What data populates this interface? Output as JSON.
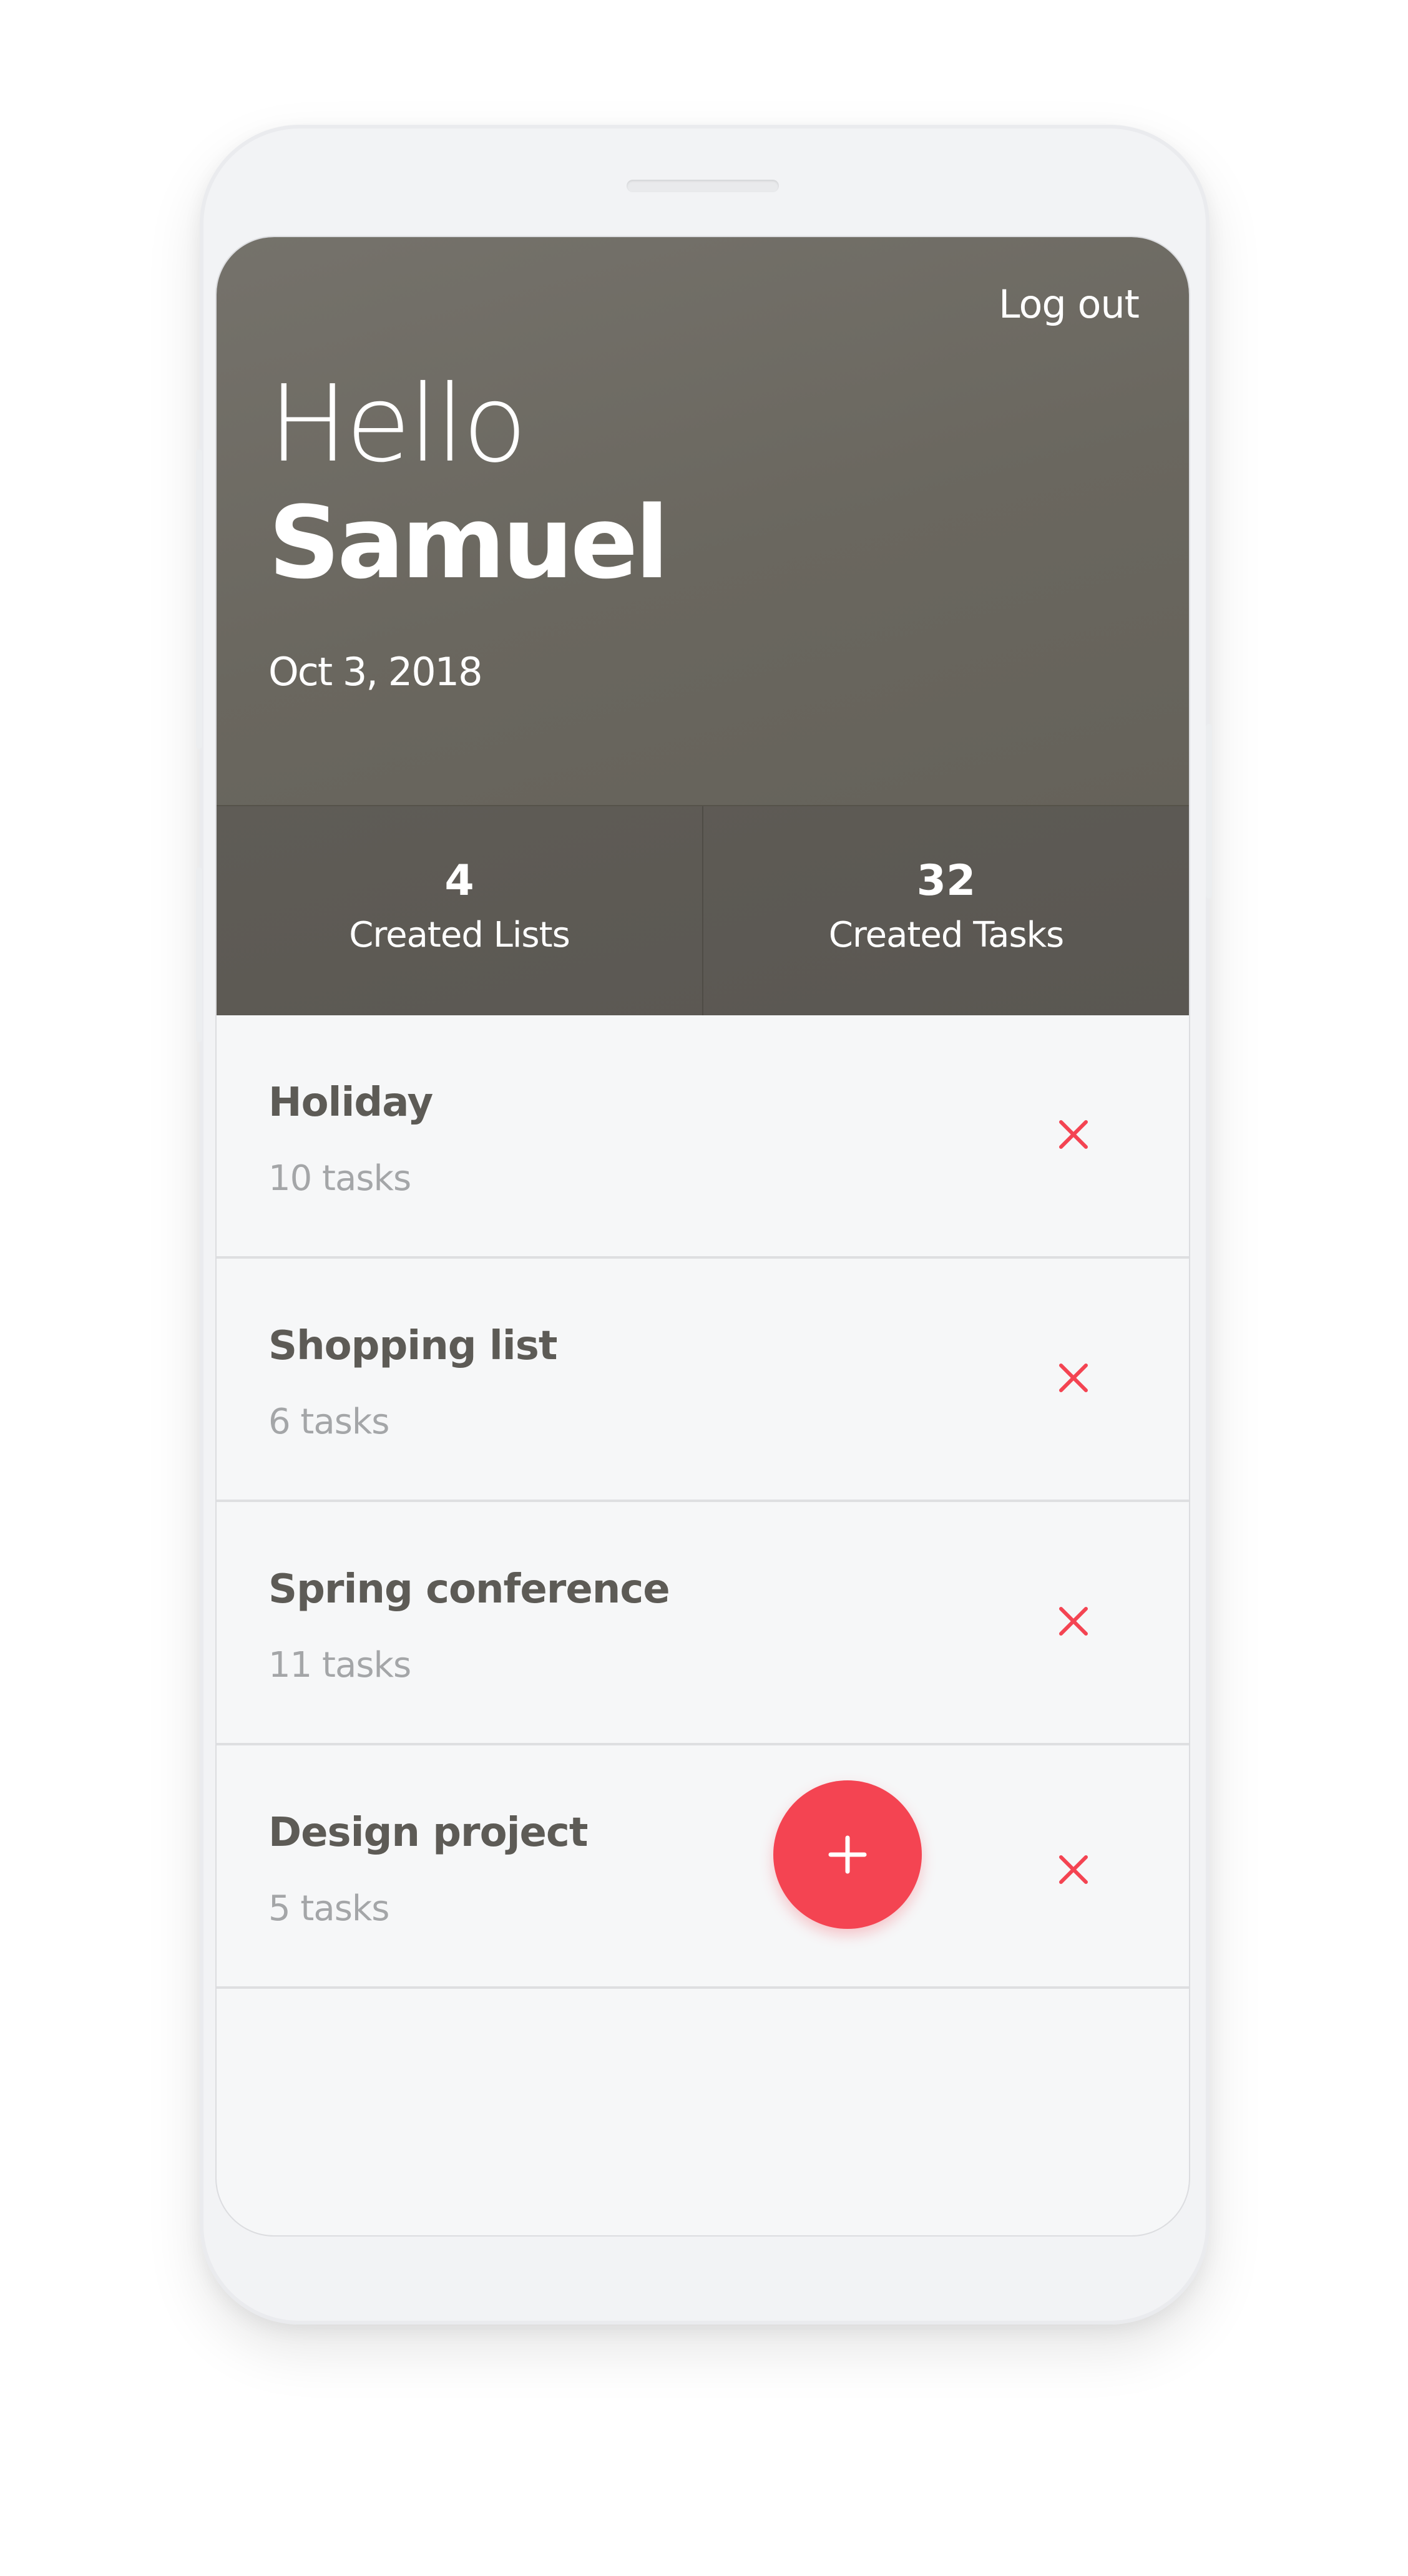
{
  "header": {
    "logout_label": "Log out",
    "greeting": "Hello",
    "user_name": "Samuel",
    "date": "Oct 3, 2018"
  },
  "stats": [
    {
      "value": "4",
      "label": "Created Lists"
    },
    {
      "value": "32",
      "label": "Created Tasks"
    }
  ],
  "lists": [
    {
      "title": "Holiday",
      "count": "10 tasks"
    },
    {
      "title": "Shopping list",
      "count": "6 tasks"
    },
    {
      "title": "Spring conference",
      "count": "11 tasks"
    },
    {
      "title": "Design project",
      "count": "5 tasks"
    }
  ],
  "icons": {
    "delete": "close-icon",
    "add": "plus-icon"
  },
  "colors": {
    "header_bg": "#6b6861",
    "stats_bg": "#5d5a54",
    "accent": "#f44452",
    "list_bg": "#f6f7f8",
    "title_text": "#5d5b56",
    "muted_text": "#a4a6a8"
  }
}
